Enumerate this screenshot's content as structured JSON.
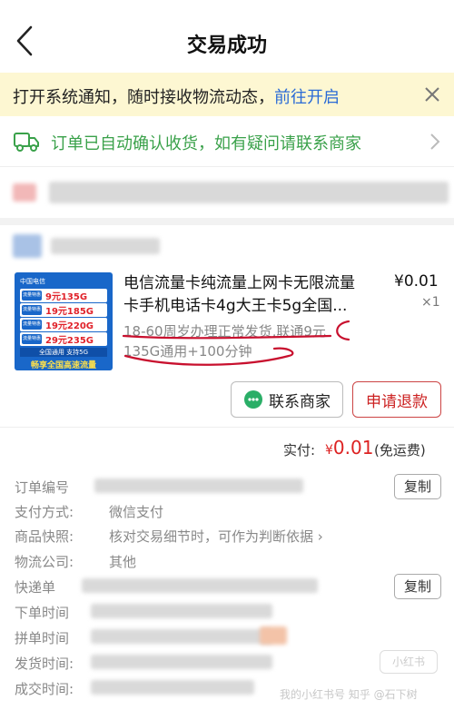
{
  "header": {
    "title": "交易成功"
  },
  "notice": {
    "text": "打开系统通知，随时接收物流动态，",
    "link": "前往开启"
  },
  "status": {
    "text": "订单已自动确认收货，如有疑问请联系商家"
  },
  "product": {
    "title_line1": "电信流量卡纯流量上网卡无限流量",
    "title_line2": "卡手机电话卡4g大王卡5g全国...",
    "price": "¥0.01",
    "quantity": "×1",
    "spec_line1": "18-60周岁办理正常发货,联通9元",
    "spec_line2": "135G通用+100分钟",
    "thumb": {
      "logo": "中国电信",
      "plans": [
        {
          "tag": "流量特惠",
          "text": "9元135G"
        },
        {
          "tag": "流量特惠",
          "text": "19元185G"
        },
        {
          "tag": "流量特惠",
          "text": "19元220G"
        },
        {
          "tag": "流量特惠",
          "text": "29元235G"
        }
      ],
      "badge": "全国通用 支持5G",
      "footer": "畅享全国高速流量"
    }
  },
  "actions": {
    "contact": "联系商家",
    "refund": "申请退款"
  },
  "total": {
    "label": "实付:",
    "currency": "¥",
    "amount": "0.01",
    "note": "(免运费)"
  },
  "details": {
    "order_no_label": "订单编号",
    "pay_method_label": "支付方式:",
    "pay_method_value": "微信支付",
    "snapshot_label": "商品快照:",
    "snapshot_value": "核对交易细节时，可作为判断依据 ›",
    "logistics_label": "物流公司:",
    "logistics_value": "其他",
    "tracking_label": "快递单",
    "order_time_label": "下单时间",
    "group_time_label": "拼单时间",
    "ship_time_label": "发货时间:",
    "deal_time_label": "成交时间:",
    "copy": "复制"
  },
  "watermark": {
    "badge": "小红书",
    "text": "我的小红书号  知乎 @石下树"
  },
  "colors": {
    "accent_green": "#3aa14a",
    "link_blue": "#2a6bd6",
    "price_red": "#d22",
    "notice_bg": "#fdf7d2"
  }
}
